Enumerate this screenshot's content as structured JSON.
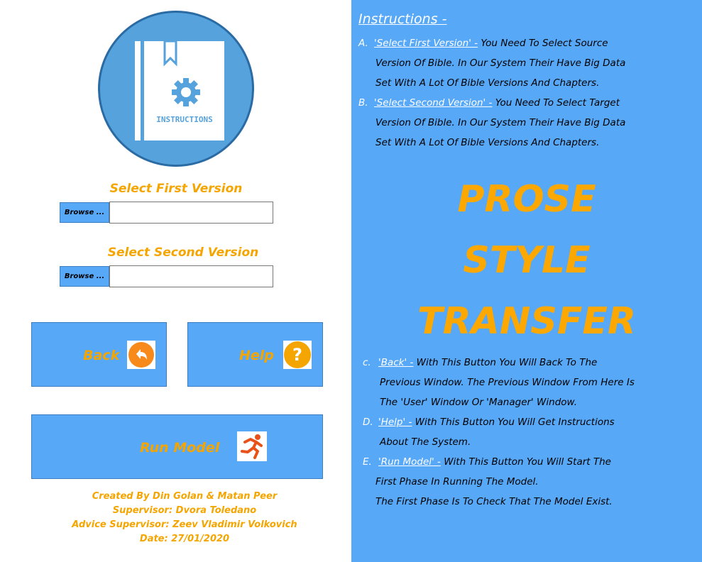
{
  "logo": {
    "text": "INSTRUCTIONS"
  },
  "first_version": {
    "label": "Select First Version",
    "browse_label": "Browse ...",
    "value": ""
  },
  "second_version": {
    "label": "Select Second Version",
    "browse_label": "Browse ...",
    "value": ""
  },
  "buttons": {
    "back": "Back",
    "help": "Help",
    "run_model": "Run Model"
  },
  "credits": {
    "line1": "Created By Din Golan & Matan Peer",
    "line2": "Supervisor: Dvora Toledano",
    "line3": "Advice Supervisor: Zeev Vladimir Volkovich",
    "line4": "Date: 27/01/2020"
  },
  "instructions": {
    "title": "Instructions -",
    "a_mark": "A.",
    "a_key": "'Select First Version' -",
    "a_l1": " You Need To Select Source",
    "a_l2": "Version Of Bible. In Our System Their Have Big Data",
    "a_l3": "Set With A Lot Of Bible Versions And Chapters.",
    "b_mark": "B.",
    "b_key": "'Select Second Version' -",
    "b_l1": " You Need To Select Target",
    "b_l2": "Version Of Bible. In Our System Their Have Big Data",
    "b_l3": "Set With A Lot Of Bible Versions And Chapters.",
    "c_mark": "c.",
    "c_key": "'Back' -",
    "c_l1": " With This Button You Will Back To The",
    "c_l2": "Previous Window. The Previous Window From Here Is",
    "c_l3": "The 'User' Window Or 'Manager' Window.",
    "d_mark": "D.",
    "d_key": "'Help' -",
    "d_l1": " With This Button You Will Get Instructions",
    "d_l2": "About The System.",
    "e_mark": "E.",
    "e_key": "'Run Model' -",
    "e_l1": " With This Button You Will Start The",
    "e_l2": "First Phase In Running The Model.",
    "e_l3": "The First Phase Is To Check That The Model Exist."
  },
  "big_title": {
    "line1": "PROSE",
    "line2": "STYLE",
    "line3": "TRANSFER"
  },
  "colors": {
    "panel_blue": "#58a8f8",
    "accent_orange": "#f5a500"
  }
}
